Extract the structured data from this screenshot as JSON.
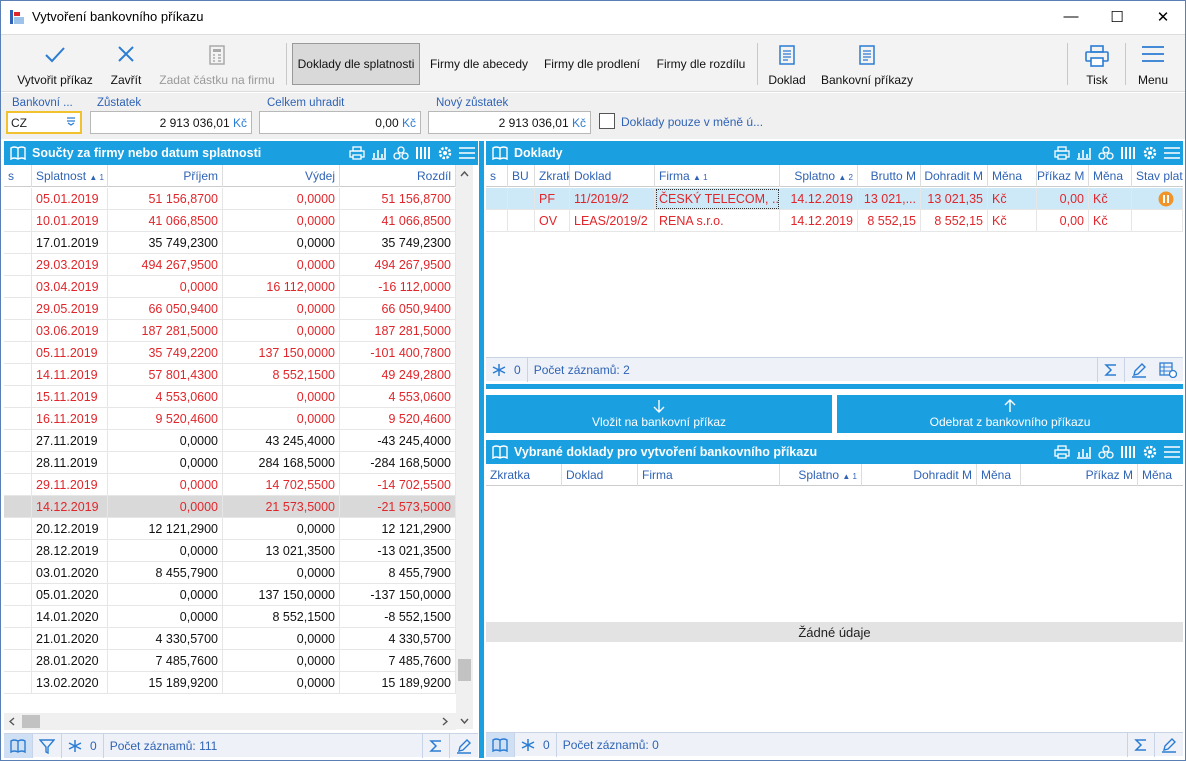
{
  "window": {
    "title": "Vytvoření bankovního příkazu",
    "minimize": "—",
    "maximize": "☐",
    "close": "✕"
  },
  "toolbar": {
    "create": "Vytvořit příkaz",
    "close": "Zavřít",
    "enter_amount": "Zadat částku na firmu",
    "by_due": "Doklady dle splatnosti",
    "by_alpha": "Firmy dle abecedy",
    "by_overdue": "Firmy dle prodlení",
    "by_diff": "Firmy dle rozdílu",
    "document": "Doklad",
    "bank_orders": "Bankovní příkazy",
    "print": "Tisk",
    "menu": "Menu"
  },
  "fields": {
    "bank_label": "Bankovní ...",
    "bank_value": "CZ",
    "balance_label": "Zůstatek",
    "balance_value": "2 913 036,01",
    "total_label": "Celkem uhradit",
    "total_value": "0,00",
    "new_balance_label": "Nový zůstatek",
    "new_balance_value": "2 913 036,01",
    "currency": "Kč",
    "only_currency_label": "Doklady pouze v měně ú..."
  },
  "left_panel": {
    "title": "Součty za firmy nebo datum splatnosti",
    "columns": [
      "s",
      "Splatnost",
      "Příjem",
      "Výdej",
      "Rozdíl"
    ],
    "sort_mark": "▲ 1",
    "rows": [
      {
        "date": "05.01.2019",
        "income": "51 156,8700",
        "expense": "0,0000",
        "diff": "51 156,8700",
        "color": "red"
      },
      {
        "date": "10.01.2019",
        "income": "41 066,8500",
        "expense": "0,0000",
        "diff": "41 066,8500",
        "color": "red"
      },
      {
        "date": "17.01.2019",
        "income": "35 749,2300",
        "expense": "0,0000",
        "diff": "35 749,2300",
        "color": "black"
      },
      {
        "date": "29.03.2019",
        "income": "494 267,9500",
        "expense": "0,0000",
        "diff": "494 267,9500",
        "color": "red"
      },
      {
        "date": "03.04.2019",
        "income": "0,0000",
        "expense": "16 112,0000",
        "diff": "-16 112,0000",
        "color": "red"
      },
      {
        "date": "29.05.2019",
        "income": "66 050,9400",
        "expense": "0,0000",
        "diff": "66 050,9400",
        "color": "red"
      },
      {
        "date": "03.06.2019",
        "income": "187 281,5000",
        "expense": "0,0000",
        "diff": "187 281,5000",
        "color": "red"
      },
      {
        "date": "05.11.2019",
        "income": "35 749,2200",
        "expense": "137 150,0000",
        "diff": "-101 400,7800",
        "color": "red"
      },
      {
        "date": "14.11.2019",
        "income": "57 801,4300",
        "expense": "8 552,1500",
        "diff": "49 249,2800",
        "color": "red"
      },
      {
        "date": "15.11.2019",
        "income": "4 553,0600",
        "expense": "0,0000",
        "diff": "4 553,0600",
        "color": "red"
      },
      {
        "date": "16.11.2019",
        "income": "9 520,4600",
        "expense": "0,0000",
        "diff": "9 520,4600",
        "color": "red"
      },
      {
        "date": "27.11.2019",
        "income": "0,0000",
        "expense": "43 245,4000",
        "diff": "-43 245,4000",
        "color": "black"
      },
      {
        "date": "28.11.2019",
        "income": "0,0000",
        "expense": "284 168,5000",
        "diff": "-284 168,5000",
        "color": "black"
      },
      {
        "date": "29.11.2019",
        "income": "0,0000",
        "expense": "14 702,5500",
        "diff": "-14 702,5500",
        "color": "red"
      },
      {
        "date": "14.12.2019",
        "income": "0,0000",
        "expense": "21 573,5000",
        "diff": "-21 573,5000",
        "color": "red",
        "selected": true
      },
      {
        "date": "20.12.2019",
        "income": "12 121,2900",
        "expense": "0,0000",
        "diff": "12 121,2900",
        "color": "black"
      },
      {
        "date": "28.12.2019",
        "income": "0,0000",
        "expense": "13 021,3500",
        "diff": "-13 021,3500",
        "color": "black"
      },
      {
        "date": "03.01.2020",
        "income": "8 455,7900",
        "expense": "0,0000",
        "diff": "8 455,7900",
        "color": "black"
      },
      {
        "date": "05.01.2020",
        "income": "0,0000",
        "expense": "137 150,0000",
        "diff": "-137 150,0000",
        "color": "black"
      },
      {
        "date": "14.01.2020",
        "income": "0,0000",
        "expense": "8 552,1500",
        "diff": "-8 552,1500",
        "color": "black"
      },
      {
        "date": "21.01.2020",
        "income": "4 330,5700",
        "expense": "0,0000",
        "diff": "4 330,5700",
        "color": "black"
      },
      {
        "date": "28.01.2020",
        "income": "7 485,7600",
        "expense": "0,0000",
        "diff": "7 485,7600",
        "color": "black"
      },
      {
        "date": "13.02.2020",
        "income": "15 189,9200",
        "expense": "0,0000",
        "diff": "15 189,9200",
        "color": "black"
      }
    ],
    "footer": {
      "zero": "0",
      "count": "Počet záznamů: 111"
    }
  },
  "docs_panel": {
    "title": "Doklady",
    "columns": [
      "s",
      "BU",
      "Zkratka",
      "Doklad",
      "Firma",
      "Splatno",
      "Brutto M",
      "Dohradit M",
      "Měna",
      "Příkaz M",
      "Měna",
      "Stav plat"
    ],
    "col_texts": {
      "abbr": "Zkratk",
      "firm": "Firma",
      "firm_sort": "▲ 1",
      "due": "Splatno",
      "due_sort": "▲ 2",
      "remain": "Dohradit M",
      "state": "Stav plat"
    },
    "rows": [
      {
        "abbr": "PF",
        "doc": "11/2019/2",
        "firm": "ČESKÝ TELECOM, ...",
        "due": "14.12.2019",
        "gross": "13 021,...",
        "remain": "13 021,35",
        "cur": "Kč",
        "order": "0,00",
        "cur2": "Kč",
        "selected": true
      },
      {
        "abbr": "OV",
        "doc": "LEAS/2019/2",
        "firm": "RENA s.r.o.",
        "due": "14.12.2019",
        "gross": "8 552,15",
        "remain": "8 552,15",
        "cur": "Kč",
        "order": "0,00",
        "cur2": "Kč",
        "selected": false
      }
    ],
    "footer": {
      "zero": "0",
      "count": "Počet záznamů: 2"
    }
  },
  "actions": {
    "insert": "Vložit na bankovní příkaz",
    "remove": "Odebrat z bankovního příkazu"
  },
  "selected_panel": {
    "title": "Vybrané doklady pro vytvoření bankovního příkazu",
    "columns": [
      "Zkratka",
      "Doklad",
      "Firma",
      "Splatno",
      "Dohradit M",
      "Měna",
      "Příkaz M",
      "Měna"
    ],
    "sort_mark": "▲ 1",
    "empty": "Žádné údaje",
    "footer": {
      "zero": "0",
      "count": "Počet záznamů: 0"
    }
  },
  "colors": {
    "accent": "#1a9fe0",
    "red": "#e0262b",
    "label_blue": "#2f63b5",
    "selected_row": "#cde8f7",
    "highlight_row": "#d9d9d9"
  }
}
